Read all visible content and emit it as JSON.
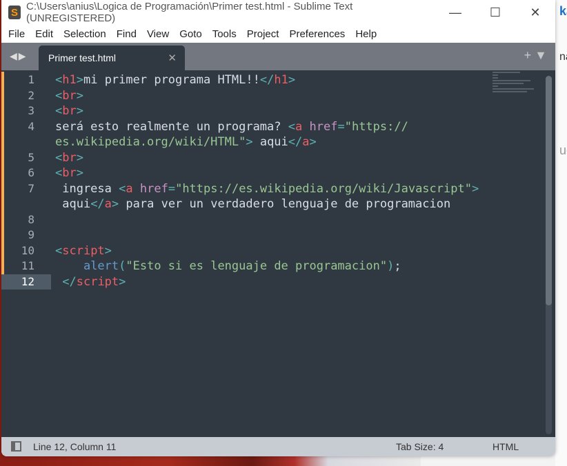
{
  "window": {
    "title": "C:\\Users\\anius\\Logica de Programación\\Primer test.html - Sublime Text (UNREGISTERED)",
    "app_icon": "S"
  },
  "menu": [
    "File",
    "Edit",
    "Selection",
    "Find",
    "View",
    "Goto",
    "Tools",
    "Project",
    "Preferences",
    "Help"
  ],
  "tab": {
    "label": "Primer test.html"
  },
  "background": {
    "text1": "ka",
    "text2": "na",
    "text3": "uc"
  },
  "colors": {
    "bracket": "#5fb3b3",
    "tag": "#ec5f67",
    "attr": "#c594c5",
    "string": "#99c794",
    "function": "#6699cc",
    "text": "#d8dee9",
    "background": "#303841",
    "modified_marker": "#f9ae58"
  },
  "lines": [
    {
      "n": "1",
      "t": [
        [
          "br",
          "<"
        ],
        [
          "tg",
          "h1"
        ],
        [
          "br",
          ">"
        ],
        [
          "tx",
          "mi primer programa HTML!!"
        ],
        [
          "br",
          "</"
        ],
        [
          "tg",
          "h1"
        ],
        [
          "br",
          ">"
        ]
      ]
    },
    {
      "n": "2",
      "t": [
        [
          "br",
          "<"
        ],
        [
          "tg",
          "br"
        ],
        [
          "br",
          ">"
        ]
      ]
    },
    {
      "n": "3",
      "t": [
        [
          "br",
          "<"
        ],
        [
          "tg",
          "br"
        ],
        [
          "br",
          ">"
        ]
      ]
    },
    {
      "n": "4",
      "t": [
        [
          "tx",
          "será esto realmente un programa? "
        ],
        [
          "br",
          "<"
        ],
        [
          "tg",
          "a"
        ],
        [
          "tx",
          " "
        ],
        [
          "at",
          "href"
        ],
        [
          "br",
          "="
        ],
        [
          "st",
          "\"https://"
        ]
      ]
    },
    {
      "n": "",
      "t": [
        [
          "st",
          "es.wikipedia.org/wiki/HTML\""
        ],
        [
          "br",
          ">"
        ],
        [
          "tx",
          " aqui"
        ],
        [
          "br",
          "</"
        ],
        [
          "tg",
          "a"
        ],
        [
          "br",
          ">"
        ]
      ]
    },
    {
      "n": "5",
      "t": [
        [
          "br",
          "<"
        ],
        [
          "tg",
          "br"
        ],
        [
          "br",
          ">"
        ]
      ]
    },
    {
      "n": "6",
      "t": [
        [
          "br",
          "<"
        ],
        [
          "tg",
          "br"
        ],
        [
          "br",
          ">"
        ]
      ]
    },
    {
      "n": "7",
      "t": [
        [
          "tx",
          " ingresa "
        ],
        [
          "br",
          "<"
        ],
        [
          "tg",
          "a"
        ],
        [
          "tx",
          " "
        ],
        [
          "at",
          "href"
        ],
        [
          "br",
          "="
        ],
        [
          "st",
          "\"https://es.wikipedia.org/wiki/Javascript\""
        ],
        [
          "br",
          ">"
        ]
      ]
    },
    {
      "n": "",
      "t": [
        [
          "tx",
          " aqui"
        ],
        [
          "br",
          "</"
        ],
        [
          "tg",
          "a"
        ],
        [
          "br",
          ">"
        ],
        [
          "tx",
          " para ver un verdadero lenguaje de programacion"
        ]
      ]
    },
    {
      "n": "8",
      "t": []
    },
    {
      "n": "9",
      "t": []
    },
    {
      "n": "10",
      "t": [
        [
          "br",
          "<"
        ],
        [
          "tg",
          "script"
        ],
        [
          "br",
          ">"
        ]
      ]
    },
    {
      "n": "11",
      "t": [
        [
          "tx",
          "    "
        ],
        [
          "fn",
          "alert"
        ],
        [
          "br",
          "("
        ],
        [
          "st",
          "\"Esto si es lenguaje de programacion\""
        ],
        [
          "br",
          ")"
        ],
        [
          "tx",
          ";"
        ]
      ]
    },
    {
      "n": "12",
      "t": [
        [
          "tx",
          " "
        ],
        [
          "br",
          "</"
        ],
        [
          "tg",
          "script"
        ],
        [
          "br",
          ">"
        ]
      ],
      "current": true
    }
  ],
  "status": {
    "position": "Line 12, Column 11",
    "tab_size": "Tab Size: 4",
    "syntax": "HTML"
  }
}
